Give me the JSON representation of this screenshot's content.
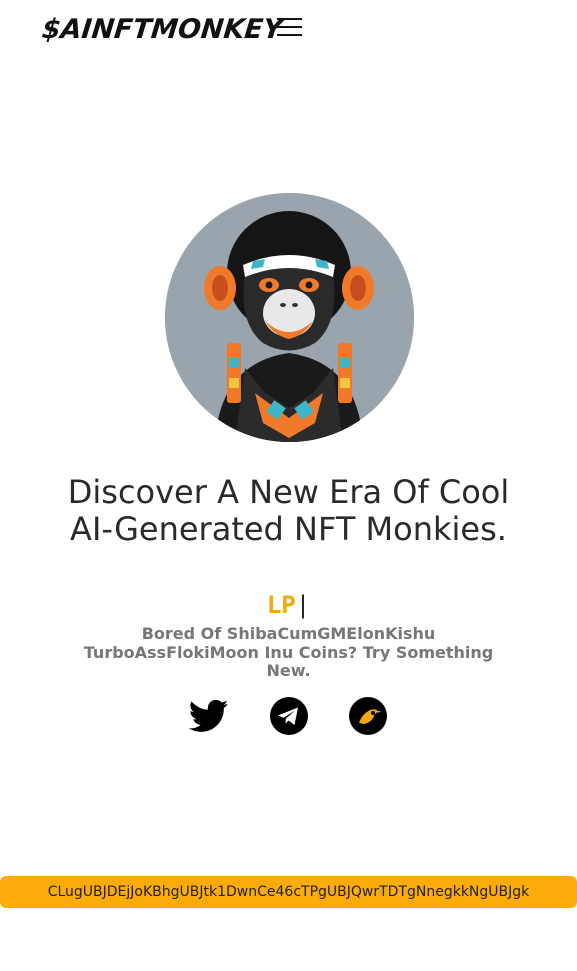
{
  "header": {
    "logo_text": "$AINFTMONKEY",
    "menu_icon": "hamburger-menu-icon"
  },
  "hero": {
    "avatar_alt": "AI-generated monkey NFT avatar",
    "headline": "Discover A New Era Of Cool AI-Generated NFT Monkies.",
    "typed_text": "LP",
    "typed_cursor": "|",
    "subtitle": "Bored Of ShibaCumGMElonKishu TurboAssFlokiMoon Inu Coins? Try Something New."
  },
  "socials": [
    {
      "name": "twitter",
      "icon": "twitter-icon"
    },
    {
      "name": "telegram",
      "icon": "telegram-icon"
    },
    {
      "name": "dextools",
      "icon": "bird-icon"
    }
  ],
  "contract": {
    "address": "CLugUBJDEjJoKBhgUBJtk1DwnCe46cTPgUBJQwrTDTgNnegkkNgUBJgk"
  },
  "colors": {
    "accent": "#fbac0b",
    "typed": "#f5a70c",
    "avatar_bg": "#9aa4ad"
  }
}
